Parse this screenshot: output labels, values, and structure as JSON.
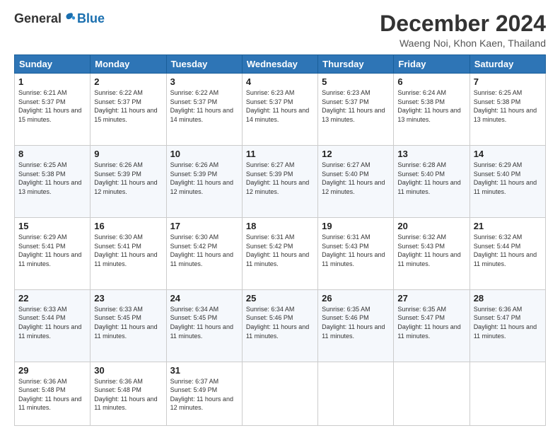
{
  "header": {
    "logo_general": "General",
    "logo_blue": "Blue",
    "month_title": "December 2024",
    "subtitle": "Waeng Noi, Khon Kaen, Thailand"
  },
  "days_of_week": [
    "Sunday",
    "Monday",
    "Tuesday",
    "Wednesday",
    "Thursday",
    "Friday",
    "Saturday"
  ],
  "weeks": [
    [
      {
        "day": "1",
        "info": "Sunrise: 6:21 AM\nSunset: 5:37 PM\nDaylight: 11 hours and 15 minutes."
      },
      {
        "day": "2",
        "info": "Sunrise: 6:22 AM\nSunset: 5:37 PM\nDaylight: 11 hours and 15 minutes."
      },
      {
        "day": "3",
        "info": "Sunrise: 6:22 AM\nSunset: 5:37 PM\nDaylight: 11 hours and 14 minutes."
      },
      {
        "day": "4",
        "info": "Sunrise: 6:23 AM\nSunset: 5:37 PM\nDaylight: 11 hours and 14 minutes."
      },
      {
        "day": "5",
        "info": "Sunrise: 6:23 AM\nSunset: 5:37 PM\nDaylight: 11 hours and 13 minutes."
      },
      {
        "day": "6",
        "info": "Sunrise: 6:24 AM\nSunset: 5:38 PM\nDaylight: 11 hours and 13 minutes."
      },
      {
        "day": "7",
        "info": "Sunrise: 6:25 AM\nSunset: 5:38 PM\nDaylight: 11 hours and 13 minutes."
      }
    ],
    [
      {
        "day": "8",
        "info": "Sunrise: 6:25 AM\nSunset: 5:38 PM\nDaylight: 11 hours and 13 minutes."
      },
      {
        "day": "9",
        "info": "Sunrise: 6:26 AM\nSunset: 5:39 PM\nDaylight: 11 hours and 12 minutes."
      },
      {
        "day": "10",
        "info": "Sunrise: 6:26 AM\nSunset: 5:39 PM\nDaylight: 11 hours and 12 minutes."
      },
      {
        "day": "11",
        "info": "Sunrise: 6:27 AM\nSunset: 5:39 PM\nDaylight: 11 hours and 12 minutes."
      },
      {
        "day": "12",
        "info": "Sunrise: 6:27 AM\nSunset: 5:40 PM\nDaylight: 11 hours and 12 minutes."
      },
      {
        "day": "13",
        "info": "Sunrise: 6:28 AM\nSunset: 5:40 PM\nDaylight: 11 hours and 11 minutes."
      },
      {
        "day": "14",
        "info": "Sunrise: 6:29 AM\nSunset: 5:40 PM\nDaylight: 11 hours and 11 minutes."
      }
    ],
    [
      {
        "day": "15",
        "info": "Sunrise: 6:29 AM\nSunset: 5:41 PM\nDaylight: 11 hours and 11 minutes."
      },
      {
        "day": "16",
        "info": "Sunrise: 6:30 AM\nSunset: 5:41 PM\nDaylight: 11 hours and 11 minutes."
      },
      {
        "day": "17",
        "info": "Sunrise: 6:30 AM\nSunset: 5:42 PM\nDaylight: 11 hours and 11 minutes."
      },
      {
        "day": "18",
        "info": "Sunrise: 6:31 AM\nSunset: 5:42 PM\nDaylight: 11 hours and 11 minutes."
      },
      {
        "day": "19",
        "info": "Sunrise: 6:31 AM\nSunset: 5:43 PM\nDaylight: 11 hours and 11 minutes."
      },
      {
        "day": "20",
        "info": "Sunrise: 6:32 AM\nSunset: 5:43 PM\nDaylight: 11 hours and 11 minutes."
      },
      {
        "day": "21",
        "info": "Sunrise: 6:32 AM\nSunset: 5:44 PM\nDaylight: 11 hours and 11 minutes."
      }
    ],
    [
      {
        "day": "22",
        "info": "Sunrise: 6:33 AM\nSunset: 5:44 PM\nDaylight: 11 hours and 11 minutes."
      },
      {
        "day": "23",
        "info": "Sunrise: 6:33 AM\nSunset: 5:45 PM\nDaylight: 11 hours and 11 minutes."
      },
      {
        "day": "24",
        "info": "Sunrise: 6:34 AM\nSunset: 5:45 PM\nDaylight: 11 hours and 11 minutes."
      },
      {
        "day": "25",
        "info": "Sunrise: 6:34 AM\nSunset: 5:46 PM\nDaylight: 11 hours and 11 minutes."
      },
      {
        "day": "26",
        "info": "Sunrise: 6:35 AM\nSunset: 5:46 PM\nDaylight: 11 hours and 11 minutes."
      },
      {
        "day": "27",
        "info": "Sunrise: 6:35 AM\nSunset: 5:47 PM\nDaylight: 11 hours and 11 minutes."
      },
      {
        "day": "28",
        "info": "Sunrise: 6:36 AM\nSunset: 5:47 PM\nDaylight: 11 hours and 11 minutes."
      }
    ],
    [
      {
        "day": "29",
        "info": "Sunrise: 6:36 AM\nSunset: 5:48 PM\nDaylight: 11 hours and 11 minutes."
      },
      {
        "day": "30",
        "info": "Sunrise: 6:36 AM\nSunset: 5:48 PM\nDaylight: 11 hours and 11 minutes."
      },
      {
        "day": "31",
        "info": "Sunrise: 6:37 AM\nSunset: 5:49 PM\nDaylight: 11 hours and 12 minutes."
      },
      {
        "day": "",
        "info": ""
      },
      {
        "day": "",
        "info": ""
      },
      {
        "day": "",
        "info": ""
      },
      {
        "day": "",
        "info": ""
      }
    ]
  ]
}
